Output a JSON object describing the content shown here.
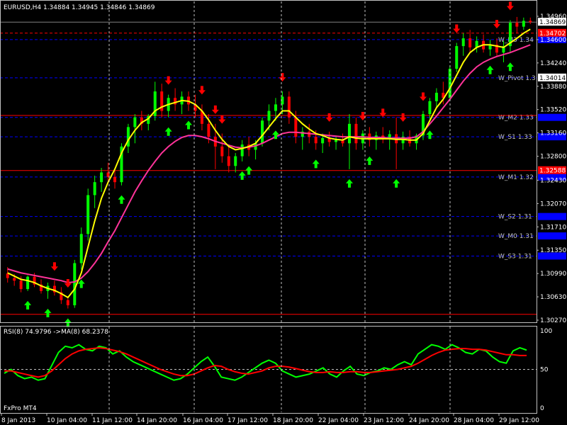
{
  "header": {
    "symbol_line": "EURUSD,H4  1.34884 1.34945 1.34846 1.34869",
    "rsi_line": "RSI(8) 74.9796  ->MA(8) 68.2378",
    "broker": "FxPro MT4"
  },
  "colors": {
    "background": "#000000",
    "bull_candle": "#00ff00",
    "bear_candle": "#ff0000",
    "fast_ma": "#ffff00",
    "slow_ma": "#ff3399",
    "up_arrow": "#00ff00",
    "down_arrow": "#ff0000",
    "pivot_line": "#0000ff",
    "rsi_line": "#00ff00",
    "rsi_ma": "#ff0000"
  },
  "chart_data": [
    {
      "type": "candlestick",
      "title": "EURUSD,H4",
      "ylim": [
        1.3027,
        1.3496
      ],
      "price_ticks": [
        1.3496,
        1.346,
        1.3424,
        1.3388,
        1.3352,
        1.3316,
        1.328,
        1.3243,
        1.3207,
        1.3171,
        1.3135,
        1.3099,
        1.3063,
        1.3027
      ],
      "price_tick_labels": [
        "1.34960",
        "1.34600",
        "1.34240",
        "1.33880",
        "1.33520",
        "1.33160",
        "1.32800",
        "1.32430",
        "1.32070",
        "1.31710",
        "1.31350",
        "1.30990",
        "1.30630",
        "1.30270"
      ],
      "time_labels": [
        "8 Jan 2013",
        "10 Jan 04:00",
        "11 Jan 12:00",
        "14 Jan 20:00",
        "16 Jan 04:00",
        "17 Jan 12:00",
        "18 Jan 20:00",
        "22 Jan 04:00",
        "23 Jan 12:00",
        "24 Jan 20:00",
        "28 Jan 04:00",
        "29 Jan 12:00"
      ],
      "levels": [
        {
          "name": "W_M3",
          "label": "W_M3 1.34",
          "price": 1.346,
          "style": "dashed",
          "color": "#0000ff",
          "tag": ""
        },
        {
          "name": "W_Pivot",
          "label": "W_Pivot 1.3",
          "price": 1.3401,
          "style": "dashed",
          "color": "#0000ff",
          "tag": "1.34014"
        },
        {
          "name": "W_M2",
          "label": "W_M2 1.33",
          "price": 1.334,
          "style": "dashed",
          "color": "#0000ff",
          "tag": ""
        },
        {
          "name": "W_S1",
          "label": "W_S1 1.33",
          "price": 1.331,
          "style": "dashed",
          "color": "#0000ff",
          "tag": ""
        },
        {
          "name": "W_M1",
          "label": "W_M1 1.32",
          "price": 1.3248,
          "style": "dashed",
          "color": "#0000ff",
          "tag": ""
        },
        {
          "name": "W_S2",
          "label": "W_S2 1.31",
          "price": 1.3187,
          "style": "dashed",
          "color": "#0000ff",
          "tag": ""
        },
        {
          "name": "W_M0",
          "label": "W_M0 1.31",
          "price": 1.3157,
          "style": "dashed",
          "color": "#0000ff",
          "tag": ""
        },
        {
          "name": "W_S3",
          "label": "W_S3 1.31",
          "price": 1.3126,
          "style": "dashed",
          "color": "#0000ff",
          "tag": ""
        },
        {
          "name": "red1",
          "label": "",
          "price": 1.347,
          "style": "dashed",
          "color": "#ff0000",
          "tag": "1.34702"
        },
        {
          "name": "red2",
          "label": "",
          "price": 1.3343,
          "style": "solid",
          "color": "#ff0000",
          "tag": ""
        },
        {
          "name": "red3",
          "label": "",
          "price": 1.3258,
          "style": "solid",
          "color": "#ff0000",
          "tag": "1.32588"
        },
        {
          "name": "red4",
          "label": "",
          "price": 1.3036,
          "style": "solid",
          "color": "#ff0000",
          "tag": ""
        },
        {
          "name": "current",
          "label": "",
          "price": 1.3487,
          "style": "solid",
          "color": "#808080",
          "tag": "1.34869"
        }
      ],
      "candles": [
        [
          1.3099,
          1.3109,
          1.3085,
          1.3092
        ],
        [
          1.3092,
          1.3098,
          1.308,
          1.3088
        ],
        [
          1.3088,
          1.3095,
          1.307,
          1.3075
        ],
        [
          1.3075,
          1.3096,
          1.3072,
          1.3094
        ],
        [
          1.3094,
          1.31,
          1.3078,
          1.3082
        ],
        [
          1.3082,
          1.309,
          1.3068,
          1.3072
        ],
        [
          1.3072,
          1.3085,
          1.306,
          1.308
        ],
        [
          1.308,
          1.3088,
          1.3065,
          1.307
        ],
        [
          1.307,
          1.3078,
          1.3052,
          1.3058
        ],
        [
          1.3058,
          1.3062,
          1.3045,
          1.305
        ],
        [
          1.305,
          1.312,
          1.3046,
          1.3115
        ],
        [
          1.3115,
          1.317,
          1.3105,
          1.316
        ],
        [
          1.316,
          1.323,
          1.315,
          1.322
        ],
        [
          1.322,
          1.325,
          1.32,
          1.324
        ],
        [
          1.324,
          1.3262,
          1.3225,
          1.3255
        ],
        [
          1.3255,
          1.327,
          1.3238,
          1.3248
        ],
        [
          1.3248,
          1.3262,
          1.323,
          1.324
        ],
        [
          1.324,
          1.33,
          1.3235,
          1.3295
        ],
        [
          1.3295,
          1.333,
          1.3285,
          1.3325
        ],
        [
          1.3325,
          1.3345,
          1.33,
          1.334
        ],
        [
          1.334,
          1.335,
          1.332,
          1.333
        ],
        [
          1.333,
          1.3345,
          1.332,
          1.3342
        ],
        [
          1.3342,
          1.3395,
          1.3335,
          1.338
        ],
        [
          1.338,
          1.3392,
          1.334,
          1.335
        ],
        [
          1.335,
          1.3375,
          1.334,
          1.337
        ],
        [
          1.337,
          1.3385,
          1.335,
          1.336
        ],
        [
          1.336,
          1.338,
          1.3345,
          1.3372
        ],
        [
          1.3372,
          1.338,
          1.335,
          1.336
        ],
        [
          1.336,
          1.3375,
          1.334,
          1.335
        ],
        [
          1.335,
          1.336,
          1.332,
          1.333
        ],
        [
          1.333,
          1.3345,
          1.33,
          1.331
        ],
        [
          1.331,
          1.333,
          1.326,
          1.3295
        ],
        [
          1.3295,
          1.3315,
          1.327,
          1.328
        ],
        [
          1.328,
          1.3295,
          1.3255,
          1.3265
        ],
        [
          1.3265,
          1.3285,
          1.3255,
          1.328
        ],
        [
          1.328,
          1.3305,
          1.3272,
          1.3298
        ],
        [
          1.3298,
          1.331,
          1.328,
          1.329
        ],
        [
          1.329,
          1.3305,
          1.3275,
          1.33
        ],
        [
          1.33,
          1.334,
          1.3295,
          1.3335
        ],
        [
          1.3335,
          1.336,
          1.332,
          1.335
        ],
        [
          1.335,
          1.337,
          1.3335,
          1.336
        ],
        [
          1.336,
          1.338,
          1.3345,
          1.3372
        ],
        [
          1.3372,
          1.338,
          1.333,
          1.334
        ],
        [
          1.334,
          1.335,
          1.33,
          1.331
        ],
        [
          1.331,
          1.3325,
          1.329,
          1.3318
        ],
        [
          1.3318,
          1.333,
          1.33,
          1.331
        ],
        [
          1.331,
          1.332,
          1.329,
          1.33
        ],
        [
          1.33,
          1.3315,
          1.3285,
          1.3308
        ],
        [
          1.3308,
          1.3318,
          1.3295,
          1.3302
        ],
        [
          1.3302,
          1.3312,
          1.329,
          1.3305
        ],
        [
          1.3305,
          1.3315,
          1.3295,
          1.33
        ],
        [
          1.33,
          1.3345,
          1.326,
          1.333
        ],
        [
          1.333,
          1.334,
          1.329,
          1.33
        ],
        [
          1.33,
          1.332,
          1.329,
          1.3315
        ],
        [
          1.3315,
          1.3325,
          1.3295,
          1.3305
        ],
        [
          1.3305,
          1.3318,
          1.329,
          1.3312
        ],
        [
          1.3312,
          1.3325,
          1.33,
          1.3306
        ],
        [
          1.3306,
          1.332,
          1.329,
          1.3314
        ],
        [
          1.3314,
          1.334,
          1.326,
          1.33
        ],
        [
          1.33,
          1.3318,
          1.329,
          1.331
        ],
        [
          1.331,
          1.332,
          1.3295,
          1.33
        ],
        [
          1.33,
          1.3315,
          1.329,
          1.3312
        ],
        [
          1.3312,
          1.335,
          1.3305,
          1.3345
        ],
        [
          1.3345,
          1.337,
          1.3335,
          1.3365
        ],
        [
          1.3365,
          1.3385,
          1.3355,
          1.3378
        ],
        [
          1.3378,
          1.3395,
          1.336,
          1.337
        ],
        [
          1.337,
          1.342,
          1.3365,
          1.3415
        ],
        [
          1.3415,
          1.3455,
          1.341,
          1.345
        ],
        [
          1.345,
          1.347,
          1.3435,
          1.3462
        ],
        [
          1.3462,
          1.3475,
          1.344,
          1.3448
        ],
        [
          1.3448,
          1.3465,
          1.344,
          1.3458
        ],
        [
          1.3458,
          1.3468,
          1.344,
          1.3445
        ],
        [
          1.3445,
          1.346,
          1.3435,
          1.3452
        ],
        [
          1.3452,
          1.3462,
          1.3435,
          1.344
        ],
        [
          1.344,
          1.3458,
          1.3425,
          1.345
        ],
        [
          1.345,
          1.349,
          1.344,
          1.3486
        ],
        [
          1.3486,
          1.3495,
          1.347,
          1.348
        ],
        [
          1.348,
          1.3494,
          1.3475,
          1.3489
        ],
        [
          1.3489,
          1.3494,
          1.3484,
          1.3487
        ]
      ],
      "ma_fast": [
        1.31,
        1.3095,
        1.309,
        1.3088,
        1.3085,
        1.308,
        1.3076,
        1.3073,
        1.3068,
        1.3062,
        1.3075,
        1.31,
        1.314,
        1.318,
        1.3215,
        1.324,
        1.326,
        1.3285,
        1.3305,
        1.332,
        1.3332,
        1.3338,
        1.335,
        1.3356,
        1.336,
        1.3363,
        1.3366,
        1.3365,
        1.336,
        1.335,
        1.3336,
        1.332,
        1.3306,
        1.3295,
        1.329,
        1.3292,
        1.3295,
        1.33,
        1.3312,
        1.3325,
        1.3338,
        1.335,
        1.335,
        1.334,
        1.333,
        1.3322,
        1.3315,
        1.3312,
        1.3308,
        1.3306,
        1.3305,
        1.331,
        1.3308,
        1.3307,
        1.3307,
        1.3307,
        1.3307,
        1.3307,
        1.3306,
        1.3306,
        1.3305,
        1.3305,
        1.3315,
        1.3335,
        1.3355,
        1.3368,
        1.3385,
        1.3405,
        1.3425,
        1.344,
        1.3448,
        1.3452,
        1.3452,
        1.345,
        1.3448,
        1.3455,
        1.3462,
        1.347,
        1.3476
      ],
      "ma_slow": [
        1.3106,
        1.3103,
        1.31,
        1.3098,
        1.3096,
        1.3094,
        1.3092,
        1.309,
        1.3088,
        1.3085,
        1.3086,
        1.3092,
        1.3102,
        1.3115,
        1.313,
        1.3148,
        1.3165,
        1.3185,
        1.3205,
        1.3225,
        1.3242,
        1.3258,
        1.3272,
        1.3285,
        1.3295,
        1.3303,
        1.3309,
        1.3312,
        1.3312,
        1.331,
        1.3307,
        1.3303,
        1.33,
        1.3297,
        1.3294,
        1.3293,
        1.3294,
        1.3296,
        1.33,
        1.3305,
        1.331,
        1.3315,
        1.3317,
        1.3317,
        1.3316,
        1.3315,
        1.3314,
        1.3313,
        1.3312,
        1.3311,
        1.331,
        1.331,
        1.331,
        1.331,
        1.3309,
        1.3309,
        1.3309,
        1.3308,
        1.3308,
        1.3308,
        1.3308,
        1.331,
        1.3318,
        1.333,
        1.3342,
        1.3355,
        1.3368,
        1.3382,
        1.3396,
        1.3408,
        1.3418,
        1.3425,
        1.343,
        1.3434,
        1.3437,
        1.344,
        1.3444,
        1.3448,
        1.3452
      ],
      "up_arrows": [
        3,
        6,
        9,
        11,
        17,
        24,
        27,
        35,
        36,
        40,
        46,
        51,
        54,
        58,
        63,
        72,
        75
      ],
      "down_arrows": [
        7,
        9,
        24,
        29,
        31,
        32,
        41,
        48,
        53,
        56,
        59,
        62,
        67,
        73,
        75
      ]
    },
    {
      "type": "line",
      "title": "RSI(8)",
      "ylim": [
        0,
        100
      ],
      "yticks": [
        100,
        50,
        0
      ],
      "levels": [
        50
      ],
      "series": [
        {
          "name": "RSI(8)",
          "color": "#00ff00",
          "values": [
            45,
            50,
            42,
            38,
            40,
            36,
            38,
            55,
            72,
            80,
            78,
            82,
            76,
            74,
            80,
            78,
            70,
            74,
            66,
            60,
            56,
            52,
            48,
            44,
            40,
            36,
            38,
            44,
            52,
            60,
            66,
            54,
            40,
            38,
            36,
            40,
            46,
            52,
            58,
            62,
            58,
            48,
            44,
            40,
            42,
            44,
            48,
            52,
            44,
            40,
            48,
            54,
            44,
            42,
            46,
            48,
            52,
            50,
            56,
            60,
            56,
            70,
            76,
            82,
            80,
            76,
            82,
            78,
            72,
            70,
            76,
            74,
            66,
            60,
            58,
            74,
            78,
            75
          ]
        },
        {
          "name": "MA(8)",
          "color": "#ff0000",
          "values": [
            48,
            48,
            46,
            44,
            42,
            40,
            42,
            48,
            56,
            64,
            70,
            74,
            76,
            77,
            78,
            77,
            75,
            73,
            70,
            66,
            62,
            58,
            54,
            50,
            47,
            44,
            42,
            42,
            44,
            48,
            52,
            55,
            54,
            50,
            47,
            45,
            44,
            46,
            48,
            52,
            54,
            54,
            53,
            51,
            49,
            47,
            46,
            46,
            47,
            46,
            46,
            47,
            47,
            46,
            46,
            47,
            48,
            49,
            50,
            52,
            54,
            58,
            63,
            68,
            72,
            75,
            76,
            77,
            77,
            76,
            76,
            75,
            73,
            71,
            69,
            69,
            68,
            68
          ]
        }
      ]
    }
  ]
}
